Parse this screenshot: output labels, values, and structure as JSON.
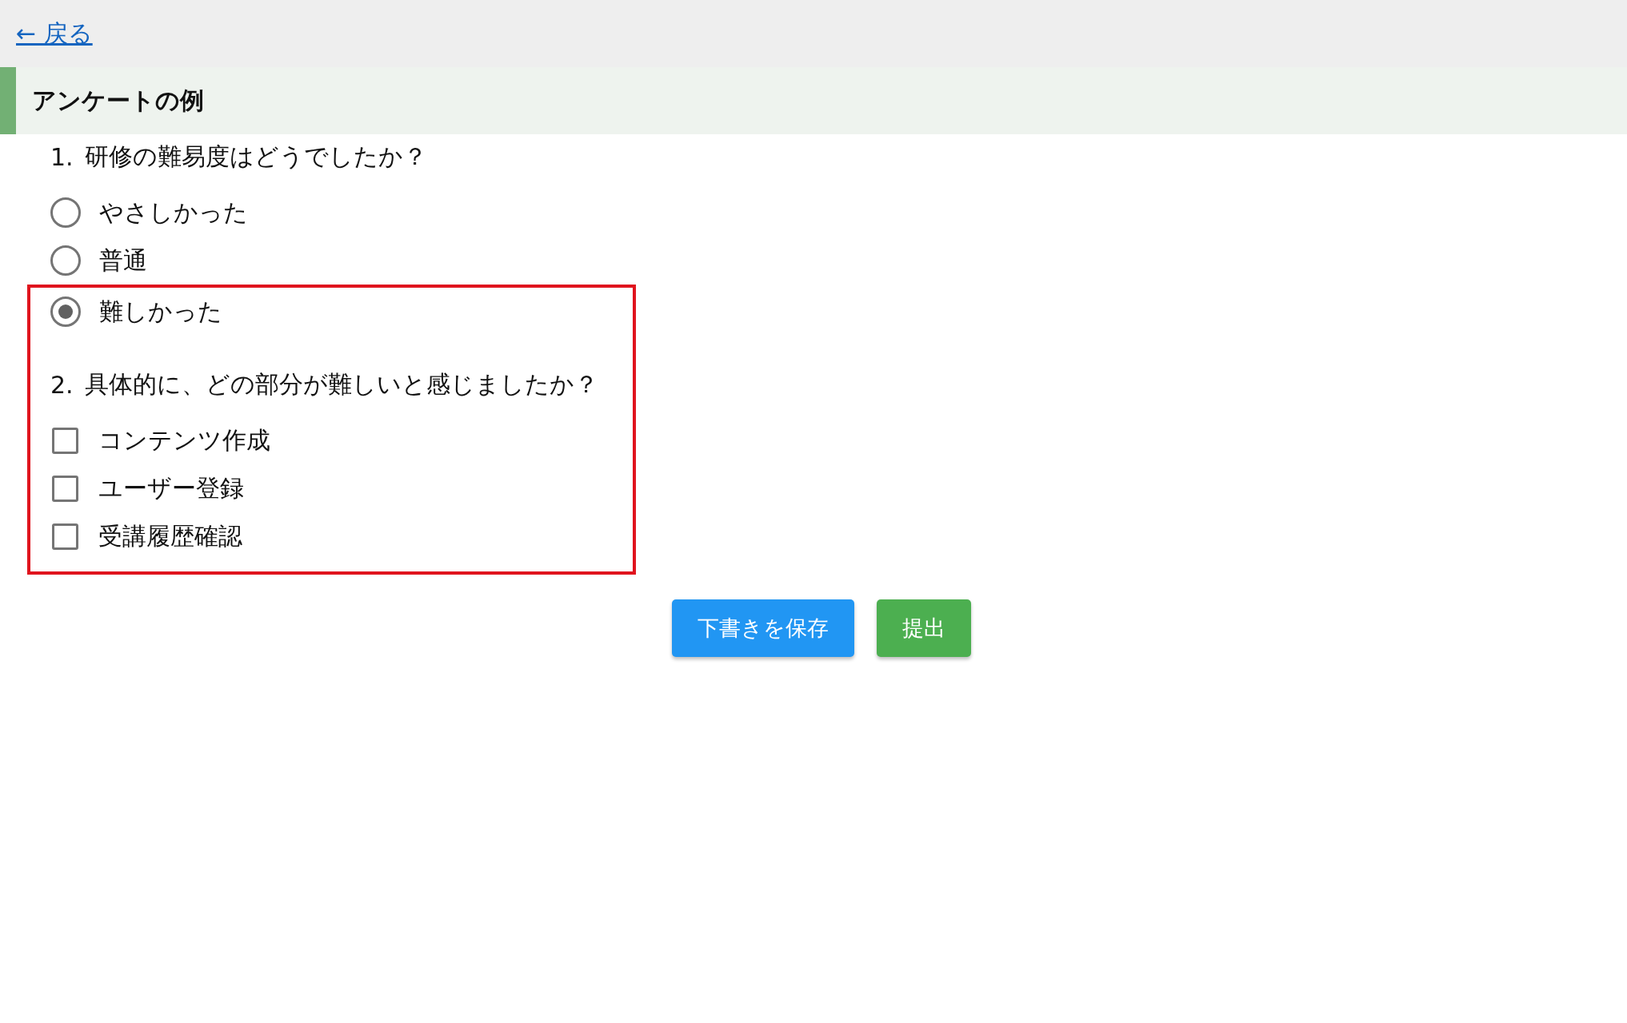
{
  "back_link": {
    "label": "← 戻る"
  },
  "title": "アンケートの例",
  "groups": [
    {
      "highlighted": false,
      "rows": [
        {
          "kind": "question",
          "number": "1.",
          "text": "研修の難易度はどうでしたか？"
        },
        {
          "kind": "radio",
          "label": "やさしかった",
          "selected": false
        },
        {
          "kind": "radio",
          "label": "普通",
          "selected": false
        }
      ]
    },
    {
      "highlighted": true,
      "rows": [
        {
          "kind": "radio",
          "label": "難しかった",
          "selected": true
        },
        {
          "kind": "question",
          "number": "2.",
          "text": "具体的に、どの部分が難しいと感じましたか？"
        },
        {
          "kind": "checkbox",
          "label": "コンテンツ作成",
          "checked": false
        },
        {
          "kind": "checkbox",
          "label": "ユーザー登録",
          "checked": false
        },
        {
          "kind": "checkbox",
          "label": "受講履歴確認",
          "checked": false
        }
      ]
    }
  ],
  "buttons": [
    {
      "kind": "draft",
      "label": "下書きを保存"
    },
    {
      "kind": "submit",
      "label": "提出"
    }
  ]
}
